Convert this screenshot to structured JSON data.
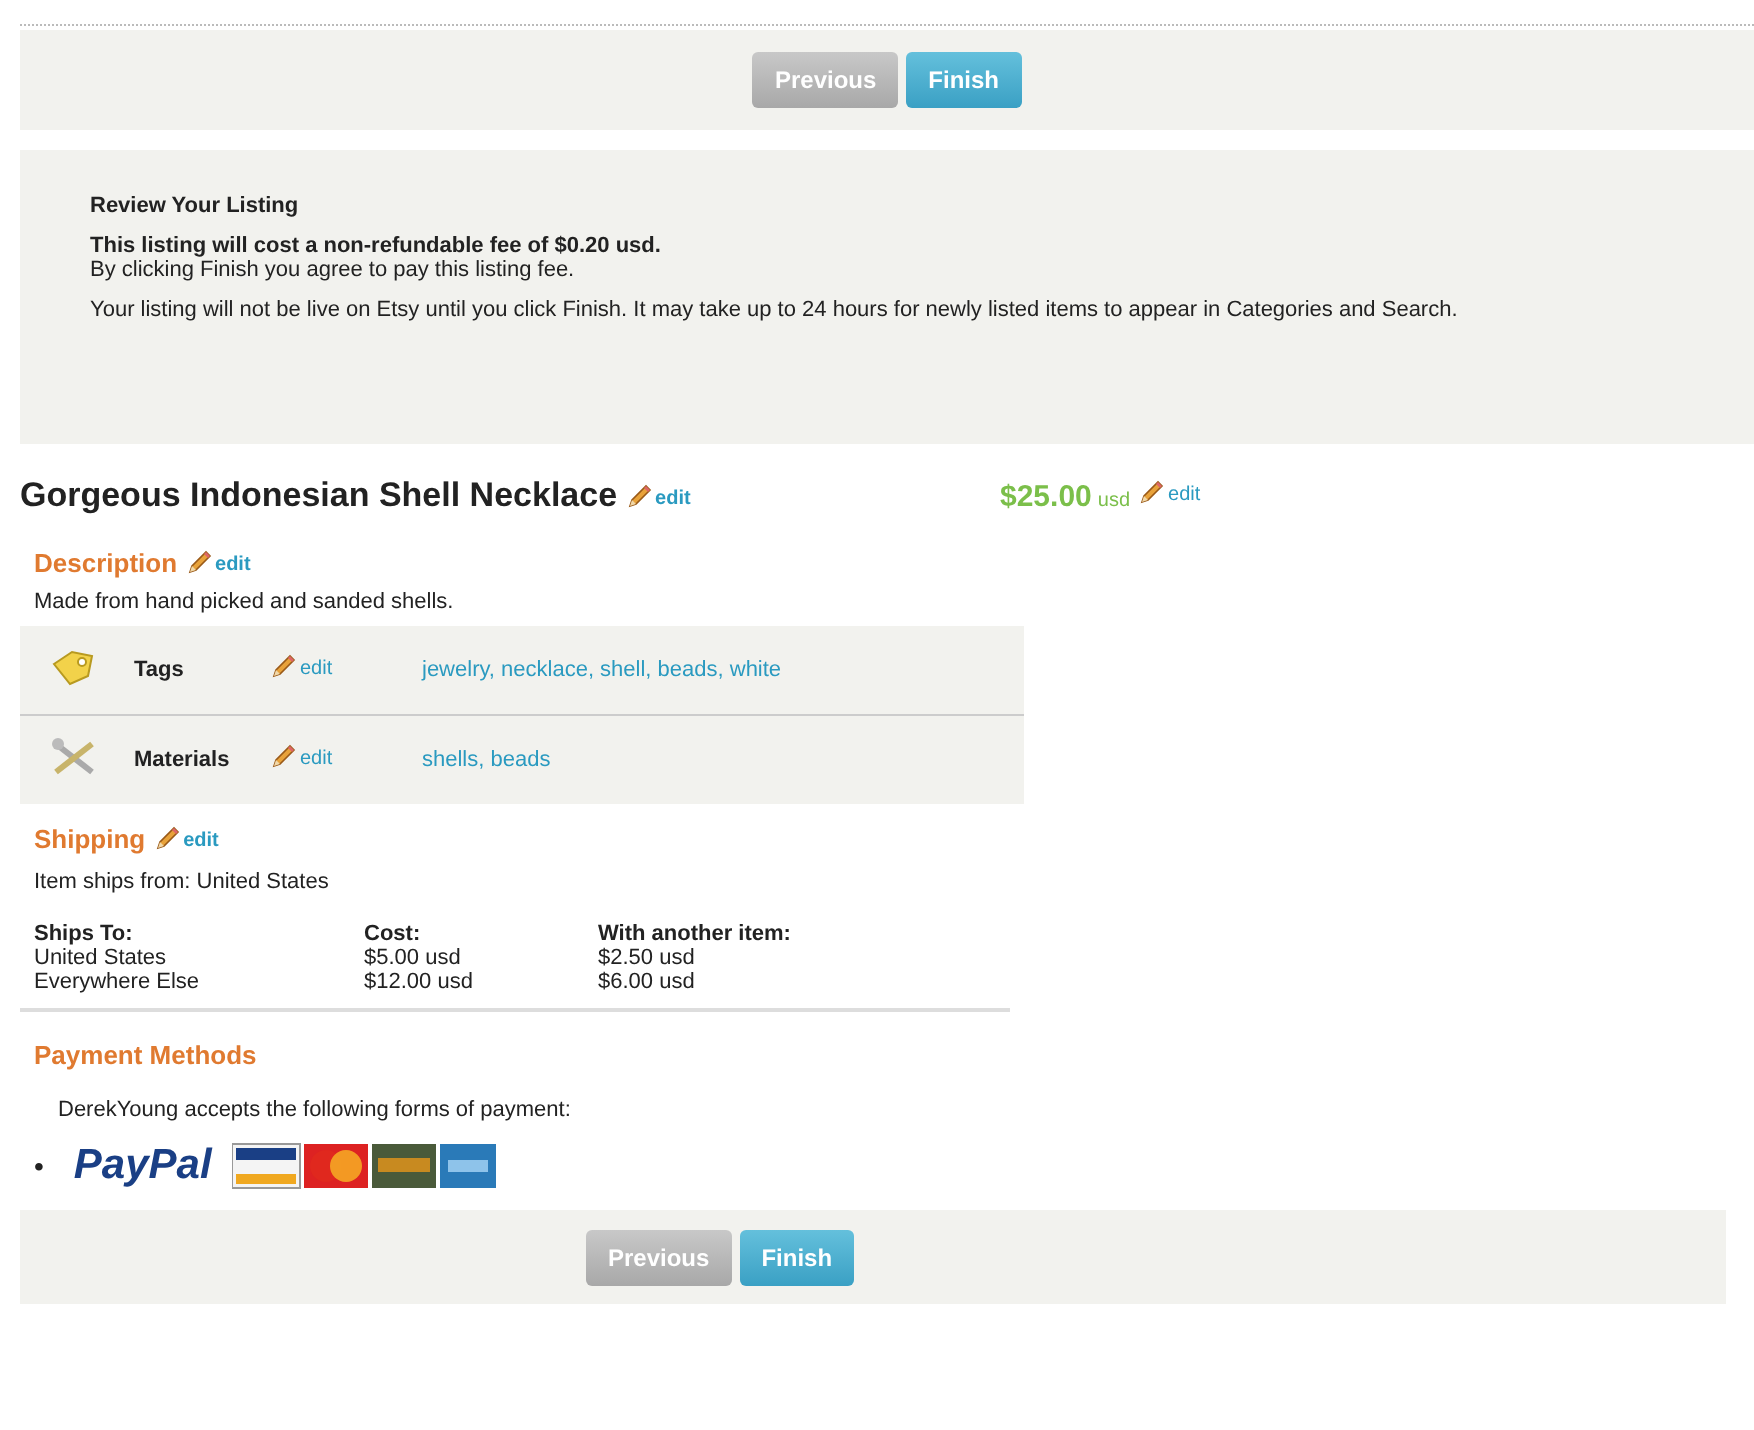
{
  "top_bar": {
    "buttons": [
      {
        "label": "Previous",
        "disabled": true
      },
      {
        "label": "Finish",
        "disabled": false
      }
    ]
  },
  "review": {
    "heading": "Review Your Listing",
    "fee_notice": "This listing will cost a non-refundable fee of $0.20 usd.",
    "agreement": "By clicking Finish you agree to pay this listing fee.",
    "live_notice": "Your listing will not be live on Etsy until you click Finish. It may take up to 24 hours for newly listed items to appear in Categories and Search."
  },
  "listing": {
    "title": "Gorgeous Indonesian Shell Necklace",
    "title_edit": "edit",
    "price": "$25.00",
    "currency": "usd",
    "price_edit": "edit"
  },
  "description": {
    "heading": "Description",
    "edit": "edit",
    "text": "Made from hand picked and sanded shells."
  },
  "attributes": [
    {
      "kind": "tags",
      "label": "Tags",
      "edit": "edit",
      "value": "jewelry, necklace, shell, beads, white"
    },
    {
      "kind": "materials",
      "label": "Materials",
      "edit": "edit",
      "value": "shells, beads"
    }
  ],
  "shipping": {
    "heading": "Shipping",
    "edit": "edit",
    "origin": "Item ships from: United States",
    "columns": [
      "Ships To:",
      "Cost:",
      "With another item:"
    ],
    "rows": [
      [
        "United States",
        "$5.00 usd",
        "$2.50 usd"
      ],
      [
        "Everywhere Else",
        "$12.00 usd",
        "$6.00 usd"
      ]
    ]
  },
  "payment": {
    "heading": "Payment Methods",
    "text": "DerekYoung accepts the following forms of payment:",
    "bullet": "•",
    "paypal": "PayPal"
  },
  "bottom_bar": {
    "buttons": [
      {
        "label": "Previous",
        "disabled": true
      },
      {
        "label": "Finish",
        "disabled": false
      }
    ]
  }
}
